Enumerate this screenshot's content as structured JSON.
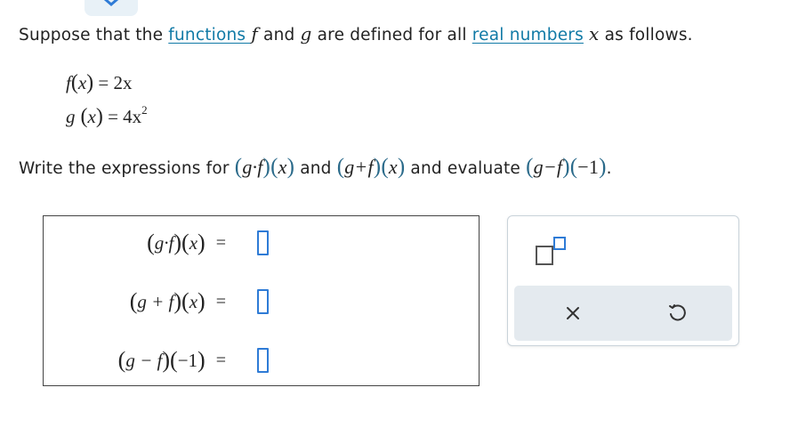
{
  "problem": {
    "intro_before": "Suppose that the ",
    "link_functions": "functions ",
    "f_var": "f",
    "and_word": " and ",
    "g_var": "g",
    "middle": " are defined for all ",
    "link_real_numbers": "real numbers",
    "x_var": "x",
    "tail": " as follows."
  },
  "definitions": {
    "f_lhs": "f",
    "f_arg": "x",
    "f_rhs": "2x",
    "g_lhs": "g",
    "g_arg": "x",
    "g_rhs_coef": "4x",
    "g_rhs_exp": "2"
  },
  "instruction": {
    "prefix": "Write the expressions for ",
    "expr1": "g·f",
    "arg1": "x",
    "and_word": " and ",
    "expr2": "g+f",
    "arg2": "x",
    "mid": " and evaluate ",
    "expr3": "g−f",
    "arg3": "−1",
    "suffix": "."
  },
  "answers": {
    "row1": {
      "expr": "g·f",
      "arg": "x",
      "equals": "="
    },
    "row2": {
      "expr": "g + f",
      "arg": "x",
      "equals": "="
    },
    "row3": {
      "expr": "g − f",
      "arg": "−1",
      "equals": "="
    }
  },
  "tools": {
    "exponent_icon": "exponent-template-icon",
    "clear_icon": "close-icon",
    "undo_icon": "undo-icon"
  },
  "colors": {
    "link": "#117aa6",
    "slot_border": "#2e7bd6",
    "toolbar_bg": "#e4eaef"
  }
}
